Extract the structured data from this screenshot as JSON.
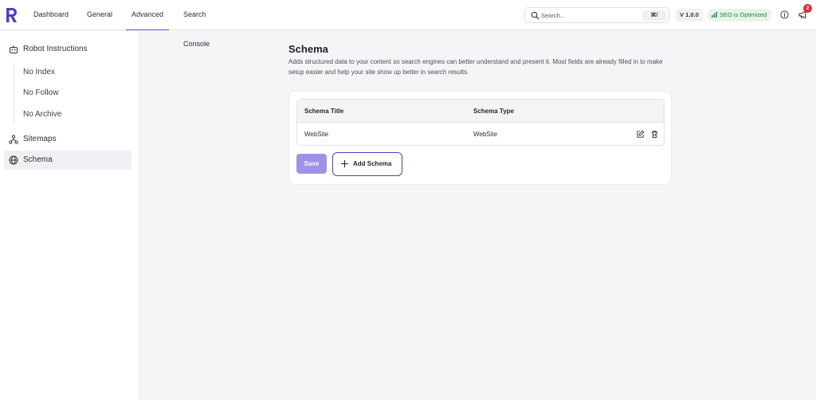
{
  "brand": {
    "accent": "#5b4fd8",
    "logo_icon": "r-logo"
  },
  "nav": {
    "tabs": [
      {
        "label": "Dashboard"
      },
      {
        "label": "General"
      },
      {
        "label": "Advanced",
        "active": true
      },
      {
        "label": "Search Console"
      }
    ]
  },
  "search": {
    "placeholder": "Search...",
    "shortcut": "⌘/"
  },
  "version": "V 1.0.0",
  "seo_status": {
    "label": "SEO is Optimized",
    "color": "#2c7a3f"
  },
  "notifications": {
    "count": "2",
    "color": "#e03131"
  },
  "sidebar": {
    "robot": {
      "label": "Robot Instructions",
      "icon": "robot-icon"
    },
    "robot_items": [
      {
        "label": "No Index"
      },
      {
        "label": "No Follow"
      },
      {
        "label": "No Archive"
      }
    ],
    "sitemaps": {
      "label": "Sitemaps",
      "icon": "sitemap-icon"
    },
    "schema": {
      "label": "Schema",
      "icon": "globe-icon",
      "active": true
    }
  },
  "main": {
    "title": "Schema",
    "description": "Adds structured data to your content so search engines can better understand and present it. Most fields are already filled in to make setup easier and help your site show up better in search results.",
    "table": {
      "headers": [
        "Schema Title",
        "Schema Type"
      ],
      "rows": [
        {
          "title": "WebSite",
          "type": "WebSite"
        }
      ]
    },
    "save_label": "Save",
    "add_label": "Add Schema"
  }
}
